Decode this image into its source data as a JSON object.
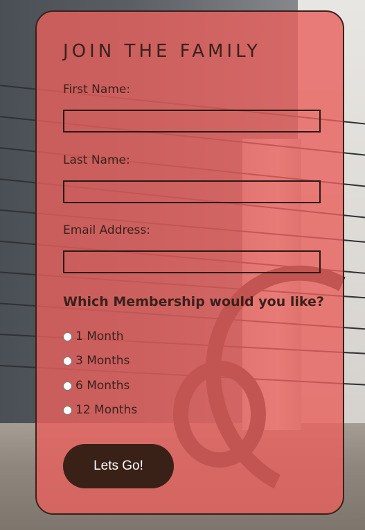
{
  "form": {
    "title": "JOIN THE FAMILY",
    "fields": [
      {
        "label": "First Name:",
        "value": ""
      },
      {
        "label": "Last Name:",
        "value": ""
      },
      {
        "label": "Email Address:",
        "value": ""
      }
    ],
    "membership_question": "Which Membership would you like?",
    "membership_options": [
      {
        "label": "1 Month",
        "selected": false
      },
      {
        "label": "3 Months",
        "selected": false
      },
      {
        "label": "6 Months",
        "selected": false
      },
      {
        "label": "12 Months",
        "selected": false
      }
    ],
    "submit_label": "Lets Go!"
  },
  "colors": {
    "card_overlay": "#e8605c",
    "text": "#3b211b",
    "button": "#3a2118",
    "button_text": "#ffffff"
  }
}
